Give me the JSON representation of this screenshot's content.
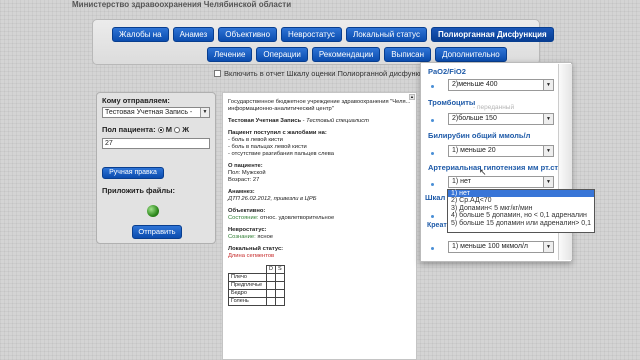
{
  "header": {
    "ministry": "Министерство здравоохранения Челябинской области"
  },
  "nav": {
    "row1": [
      "Жалобы на",
      "Анамез",
      "Объективно",
      "Невростатус",
      "Локальный статус",
      "Полиорганная Дисфункция"
    ],
    "row2": [
      "Лечение",
      "Операции",
      "Рекомендации",
      "Выписан",
      "Дополнительно"
    ]
  },
  "include_label": "Включить в отчет Шкалу оценки Полиорганной дисфункции",
  "left_panel": {
    "send_to_label": "Кому отправляем:",
    "send_to_value": "Тестовая Учетная Запись -",
    "gender_label": "Пол пациента:",
    "gender_m": "М",
    "gender_f": "Ж",
    "age_value": "27",
    "manual_button": "Ручная правка",
    "attach_label": "Приложить файлы:",
    "send_button": "Отправить"
  },
  "doc": {
    "institution": "Государственное бюджетное учреждение здравоохранения \"Челя... информационно-аналитический центр\"",
    "account": "Тестовая Учетная Запись",
    "account_role": "Тестовый специалист",
    "complaints_title": "Пациент поступил с жалобами на:",
    "complaints": [
      "- боль в левой кисти",
      "- боль в пальцах левой кисти",
      "- отсутствие разгибания пальцев слева"
    ],
    "patient_title": "О пациенте:",
    "gender_line": "Пол: Мужской",
    "age_line": "Возраст: 27",
    "anamnesis_title": "Анамнез:",
    "anamnesis": "ДТП 26.02.2012, привезли в ЦРБ",
    "objective_title": "Объективно:",
    "objective_key": "Состояние:",
    "objective_val": "относ. удовлетворительное",
    "neuro_title": "Невростатус:",
    "neuro_key": "Сознание:",
    "neuro_val": "ясное",
    "local_title": "Локальный статус:",
    "local_val": "Длина сегментов",
    "table_head": [
      "D",
      "S"
    ],
    "table_rows": [
      "Плечо",
      "Предплечье",
      "Бедро",
      "Голень"
    ]
  },
  "overlay": {
    "pao2_label": "PaO2/FiO2",
    "pao2_value": "2)меньше 400",
    "platelets_label": "Тромбоциты",
    "platelets_ghost": "- переданный",
    "platelets_value": "2)больше 150",
    "bilirubin_label": "Билирубин общий ммоль/л",
    "bilirubin_value": "1) меньше 20",
    "hypotension_label": "Артериальная гипотензия мм рт.ст.",
    "hypotension_value": "1) нет",
    "glasgow_label": "Шкал",
    "creatinine_label": "Креатинин. Объем мочи в сутки",
    "creatinine_value": "1) меньше 100 мкмол/л"
  },
  "dropdown": {
    "options": [
      "1) нет",
      "2) Ср.АД<70",
      "3) Допамин< 5 мкг/кг/мин",
      "4) больше 5 допамин, но < 0,1 адреналин",
      "5) больше 15 допамин или адреналин> 0,1"
    ],
    "selected_index": 0
  }
}
